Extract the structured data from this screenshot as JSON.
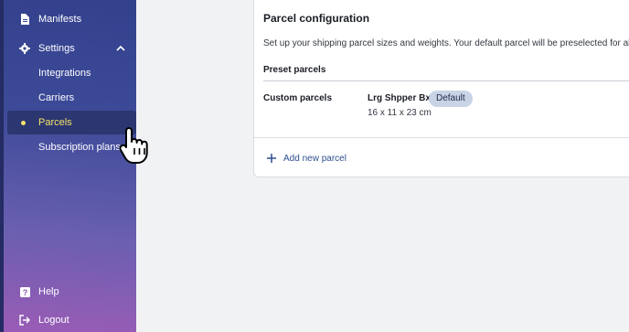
{
  "sidebar": {
    "items": [
      {
        "label": "Manifests",
        "icon": "document-icon"
      },
      {
        "label": "Settings",
        "icon": "gear-icon"
      },
      {
        "label": "Integrations"
      },
      {
        "label": "Carriers"
      },
      {
        "label": "Parcels"
      },
      {
        "label": "Subscription plans"
      }
    ],
    "bottom": [
      {
        "label": "Help",
        "icon": "help-icon"
      },
      {
        "label": "Logout",
        "icon": "logout-icon"
      }
    ],
    "active_color": "#f4e46a"
  },
  "card": {
    "title": "Parcel configuration",
    "description": "Set up your shipping parcel sizes and weights. Your default parcel will be preselected for all ord",
    "section": "Preset parcels",
    "row_label": "Custom parcels",
    "parcel": {
      "name": "Lrg Shpper Bx",
      "badge": "Default",
      "dims": "16 x 11 x 23 cm"
    },
    "add_label": "Add new parcel"
  }
}
